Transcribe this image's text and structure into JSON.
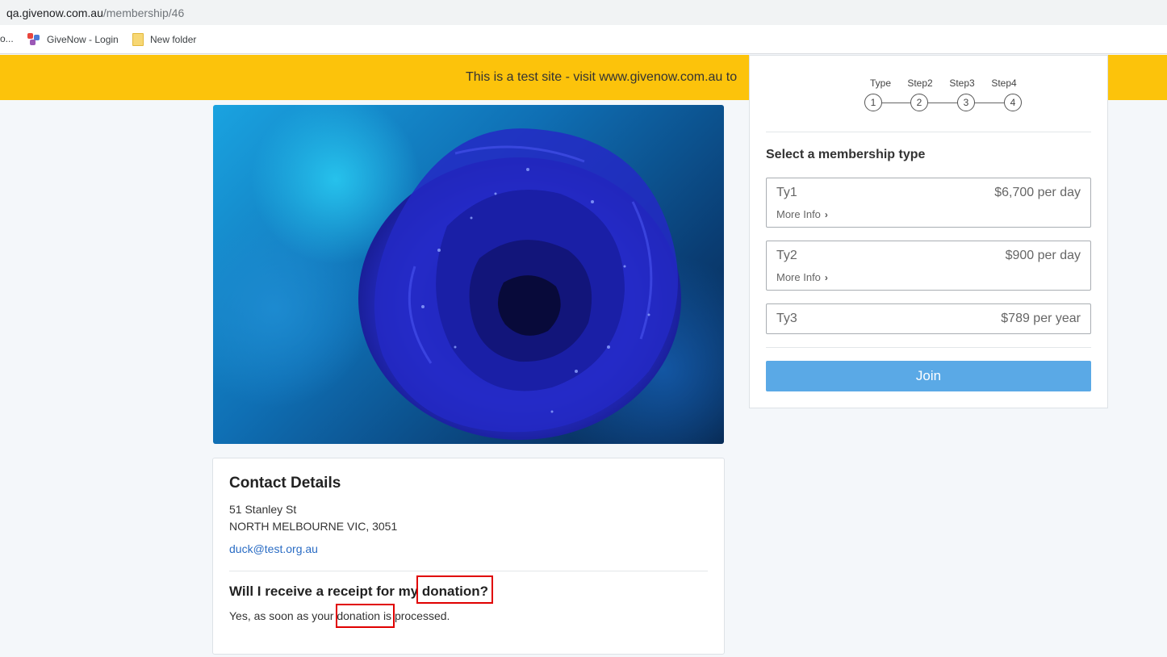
{
  "browser": {
    "url_host": "qa.givenow.com.au",
    "url_path": "/membership/46",
    "bookmarks": [
      {
        "label": "o..."
      },
      {
        "label": "GiveNow - Login"
      },
      {
        "label": "New folder"
      }
    ]
  },
  "banner": {
    "text": "This is a test site - visit www.givenow.com.au to"
  },
  "contact": {
    "heading": "Contact Details",
    "address_line1": "51 Stanley St",
    "address_line2": "NORTH MELBOURNE VIC, 3051",
    "email": "duck@test.org.au"
  },
  "faq": {
    "question": "Will I receive a receipt for my donation?",
    "answer": "Yes, as soon as your donation is processed."
  },
  "membership": {
    "steps": [
      {
        "label": "Type",
        "number": "1"
      },
      {
        "label": "Step2",
        "number": "2"
      },
      {
        "label": "Step3",
        "number": "3"
      },
      {
        "label": "Step4",
        "number": "4"
      }
    ],
    "title": "Select a membership type",
    "options": [
      {
        "name": "Ty1",
        "price": "$6,700 per day",
        "more_info": "More Info"
      },
      {
        "name": "Ty2",
        "price": "$900 per day",
        "more_info": "More Info"
      },
      {
        "name": "Ty3",
        "price": "$789 per year"
      }
    ],
    "join_label": "Join"
  }
}
